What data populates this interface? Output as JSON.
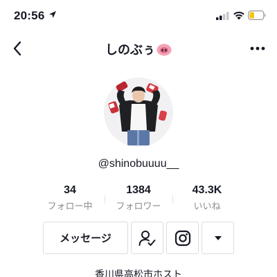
{
  "status_bar": {
    "time": "20:56"
  },
  "profile": {
    "display_name": "しのぶぅ",
    "username": "@shinobuuuu__",
    "bio": "香川県高松市ホスト"
  },
  "stats": {
    "following_count": "34",
    "following_label": "フォロー中",
    "followers_count": "1384",
    "followers_label": "フォロワー",
    "likes_count": "43.3K",
    "likes_label": "いいね"
  },
  "actions": {
    "message_label": "メッセージ"
  },
  "icons": {
    "back": "chevron-left-icon",
    "more": "more-horizontal-icon",
    "pig": "pig-nose-emoji",
    "friend": "add-friend-icon",
    "instagram": "instagram-icon",
    "dropdown": "triangle-down-icon"
  },
  "colors": {
    "text_primary": "#161823",
    "text_secondary": "#8a8b91",
    "border": "#dcdce0",
    "battery_low": "#f5c518"
  }
}
